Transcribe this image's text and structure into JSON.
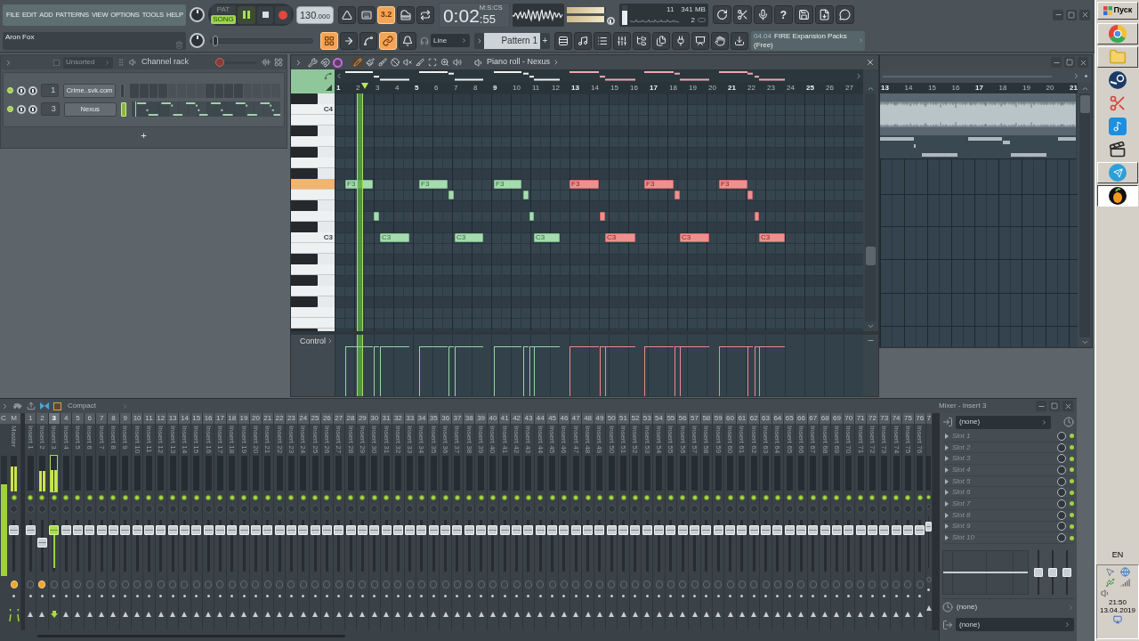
{
  "menu": [
    "FILE",
    "EDIT",
    "ADD",
    "PATTERNS",
    "VIEW",
    "OPTIONS",
    "TOOLS",
    "HELP"
  ],
  "hint_bar": {
    "text": "Aron Fox"
  },
  "transport": {
    "modes": [
      {
        "label": "PAT",
        "selected": false
      },
      {
        "label": "SONG",
        "selected": true
      }
    ],
    "playing": true,
    "tempo": "130",
    "tempo_decimals": ".000"
  },
  "toolbar": {
    "top": [
      {
        "on": false
      },
      {
        "on": false
      },
      {
        "label": "3.2",
        "on": true
      },
      {
        "on": false
      },
      {
        "on": false
      }
    ],
    "bottom": [
      {
        "on": true
      },
      {
        "on": false
      },
      {
        "on": false
      },
      {
        "on": true
      },
      {
        "on": false
      }
    ],
    "help_label": "?"
  },
  "time_display": {
    "value": "0:02",
    "centiseconds": ":55",
    "format": "M:S:CS"
  },
  "output_meter": {
    "left": {
      "level": 0.95
    },
    "right": {
      "level": 0.95
    }
  },
  "cpu_panel": {
    "cpu": {
      "level": 0.7
    },
    "cpu_value": "11",
    "memory": "341 MB",
    "polyphony": "2"
  },
  "pitch_slider": {
    "level": 0.05
  },
  "snap": {
    "value": "Line"
  },
  "pattern": {
    "name": "Pattern 1",
    "add": "+"
  },
  "news": {
    "date": "04.04",
    "title": "FIRE Expansion Packs",
    "subtitle": "(Free)"
  },
  "channel_rack": {
    "filter": "Unsorted",
    "title": "Channel rack",
    "slider": {
      "level": 0.1
    },
    "channels": [
      {
        "kind": "steps",
        "on": true,
        "number": "1",
        "name": "Crime..svk.com",
        "selected": false,
        "steps": [
          {
            "on": false
          },
          {
            "on": false
          },
          {
            "on": false
          },
          {
            "on": false
          },
          {
            "on": false
          },
          {
            "on": false
          },
          {
            "on": false
          },
          {
            "on": false
          },
          {
            "on": false
          },
          {
            "on": false
          },
          {
            "on": false
          },
          {
            "on": false
          },
          {
            "on": false
          },
          {
            "on": false
          },
          {
            "on": false
          },
          {
            "on": false
          }
        ]
      },
      {
        "kind": "piano_roll",
        "on": true,
        "number": "3",
        "name": "Nexus",
        "selected": true
      }
    ],
    "add": "+"
  },
  "piano_roll": {
    "title": "Piano roll - Nexus",
    "tools": [
      {
        "selected": true
      },
      {
        "selected": false
      },
      {
        "selected": false
      },
      {
        "selected": false
      },
      {
        "selected": false
      },
      {
        "selected": false
      },
      {
        "selected": false
      },
      {
        "selected": false
      },
      {
        "selected": false
      }
    ],
    "ruler": [
      "1",
      "2",
      "3",
      "4",
      "5",
      "6",
      "7",
      "8",
      "9",
      "10",
      "11",
      "12",
      "13",
      "14",
      "15",
      "16",
      "17",
      "18",
      "19",
      "20",
      "21",
      "22",
      "23",
      "24",
      "25",
      "26",
      "27"
    ],
    "keys": [
      {
        "label": "C4",
        "selected": false
      },
      {
        "selected": false
      },
      {
        "selected": false
      },
      {
        "selected": false
      },
      {
        "selected": true
      },
      {
        "selected": false
      },
      {
        "selected": false
      },
      {
        "label": "C3",
        "selected": false
      },
      {
        "selected": false
      },
      {
        "selected": false
      },
      {
        "selected": false
      },
      {
        "selected": false
      },
      {
        "selected": false
      }
    ],
    "notes": [
      {
        "label": "F3",
        "selected": false
      },
      {
        "selected": false
      },
      {
        "label": "C3",
        "selected": false
      },
      {
        "label": "F3",
        "selected": false
      },
      {
        "selected": false
      },
      {
        "label": "C3",
        "selected": false
      },
      {
        "label": "F3",
        "selected": false
      },
      {
        "selected": false
      },
      {
        "selected": false
      },
      {
        "label": "C3",
        "selected": false
      },
      {
        "label": "F3",
        "selected": true
      },
      {
        "selected": true
      },
      {
        "label": "C3",
        "selected": true
      },
      {
        "label": "F3",
        "selected": true
      },
      {
        "selected": true
      },
      {
        "label": "C3",
        "selected": true
      },
      {
        "label": "F3",
        "selected": true
      },
      {
        "selected": true
      },
      {
        "selected": true
      },
      {
        "label": "C3",
        "selected": true
      }
    ],
    "playhead": {
      "level": 0.047
    },
    "control_label": "Control"
  },
  "playlist": {
    "ruler": [
      "13",
      "14",
      "15",
      "16",
      "17",
      "18",
      "19",
      "20",
      "21"
    ]
  },
  "mixer": {
    "view": "Compact",
    "current": {
      "number": "C",
      "meter": {
        "level": 0.76
      }
    },
    "master": {
      "number": "M",
      "label": "Master",
      "on": true,
      "knob_lit": true,
      "meter": {
        "level": 0.7
      },
      "fader": {
        "level": 0.88
      }
    },
    "inserts": [
      {
        "number": "1",
        "label": "Insert 1",
        "selected": false,
        "on": true,
        "knob_lit": false,
        "meter": {
          "level": 0
        },
        "fader": {
          "level": 0.88
        }
      },
      {
        "number": "2",
        "label": "Insert 2",
        "selected": false,
        "on": true,
        "knob_lit": true,
        "meter": {
          "level": 0.58
        },
        "fader": {
          "level": 0.58
        }
      },
      {
        "number": "3",
        "label": "Insert 3",
        "selected": true,
        "on": true,
        "knob_lit": false,
        "meter": {
          "level": 0.6
        },
        "fader": {
          "level": 0.88
        }
      },
      {
        "number": "4",
        "label": "Insert 4",
        "selected": false,
        "on": true,
        "knob_lit": false,
        "meter": {
          "level": 0
        },
        "fader": {
          "level": 0.88
        }
      },
      {
        "number": "5",
        "label": "Insert 5",
        "selected": false,
        "on": true,
        "knob_lit": false,
        "meter": {
          "level": 0
        },
        "fader": {
          "level": 0.88
        }
      },
      {
        "number": "6",
        "label": "Insert 6",
        "selected": false,
        "on": true,
        "knob_lit": false,
        "meter": {
          "level": 0
        },
        "fader": {
          "level": 0.88
        }
      },
      {
        "number": "7",
        "label": "Insert 7",
        "selected": false,
        "on": true,
        "knob_lit": false,
        "meter": {
          "level": 0
        },
        "fader": {
          "level": 0.88
        }
      },
      {
        "number": "8",
        "label": "Insert 8",
        "selected": false,
        "on": true,
        "knob_lit": false,
        "meter": {
          "level": 0
        },
        "fader": {
          "level": 0.88
        }
      },
      {
        "number": "9",
        "label": "Insert 9",
        "selected": false,
        "on": true,
        "knob_lit": false,
        "meter": {
          "level": 0
        },
        "fader": {
          "level": 0.88
        }
      },
      {
        "number": "10",
        "label": "Insert 10",
        "selected": false,
        "on": true,
        "knob_lit": false,
        "meter": {
          "level": 0
        },
        "fader": {
          "level": 0.88
        }
      },
      {
        "number": "11",
        "label": "Insert 11",
        "selected": false,
        "on": true,
        "knob_lit": false,
        "meter": {
          "level": 0
        },
        "fader": {
          "level": 0.88
        }
      },
      {
        "number": "12",
        "label": "Insert 12",
        "selected": false,
        "on": true,
        "knob_lit": false,
        "meter": {
          "level": 0
        },
        "fader": {
          "level": 0.88
        }
      },
      {
        "number": "13",
        "label": "Insert 13",
        "selected": false,
        "on": true,
        "knob_lit": false,
        "meter": {
          "level": 0
        },
        "fader": {
          "level": 0.88
        }
      },
      {
        "number": "14",
        "label": "Insert 14",
        "selected": false,
        "on": true,
        "knob_lit": false,
        "meter": {
          "level": 0
        },
        "fader": {
          "level": 0.88
        }
      },
      {
        "number": "15",
        "label": "Insert 15",
        "selected": false,
        "on": true,
        "knob_lit": false,
        "meter": {
          "level": 0
        },
        "fader": {
          "level": 0.88
        }
      },
      {
        "number": "16",
        "label": "Insert 16",
        "selected": false,
        "on": true,
        "knob_lit": false,
        "meter": {
          "level": 0
        },
        "fader": {
          "level": 0.88
        }
      },
      {
        "number": "17",
        "label": "Insert 17",
        "selected": false,
        "on": true,
        "knob_lit": false,
        "meter": {
          "level": 0
        },
        "fader": {
          "level": 0.88
        }
      },
      {
        "number": "18",
        "label": "Insert 18",
        "selected": false,
        "on": true,
        "knob_lit": false,
        "meter": {
          "level": 0
        },
        "fader": {
          "level": 0.88
        }
      },
      {
        "number": "19",
        "label": "Insert 19",
        "selected": false,
        "on": true,
        "knob_lit": false,
        "meter": {
          "level": 0
        },
        "fader": {
          "level": 0.88
        }
      },
      {
        "number": "20",
        "label": "Insert 20",
        "selected": false,
        "on": true,
        "knob_lit": false,
        "meter": {
          "level": 0
        },
        "fader": {
          "level": 0.88
        }
      },
      {
        "number": "21",
        "label": "Insert 21",
        "selected": false,
        "on": true,
        "knob_lit": false,
        "meter": {
          "level": 0
        },
        "fader": {
          "level": 0.88
        }
      },
      {
        "number": "22",
        "label": "Insert 22",
        "selected": false,
        "on": true,
        "knob_lit": false,
        "meter": {
          "level": 0
        },
        "fader": {
          "level": 0.88
        }
      },
      {
        "number": "23",
        "label": "Insert 23",
        "selected": false,
        "on": true,
        "knob_lit": false,
        "meter": {
          "level": 0
        },
        "fader": {
          "level": 0.88
        }
      },
      {
        "number": "24",
        "label": "Insert 24",
        "selected": false,
        "on": true,
        "knob_lit": false,
        "meter": {
          "level": 0
        },
        "fader": {
          "level": 0.88
        }
      },
      {
        "number": "25",
        "label": "Insert 25",
        "selected": false,
        "on": true,
        "knob_lit": false,
        "meter": {
          "level": 0
        },
        "fader": {
          "level": 0.88
        }
      },
      {
        "number": "26",
        "label": "Insert 26",
        "selected": false,
        "on": true,
        "knob_lit": false,
        "meter": {
          "level": 0
        },
        "fader": {
          "level": 0.88
        }
      },
      {
        "number": "27",
        "label": "Insert 27",
        "selected": false,
        "on": true,
        "knob_lit": false,
        "meter": {
          "level": 0
        },
        "fader": {
          "level": 0.88
        }
      },
      {
        "number": "28",
        "label": "Insert 28",
        "selected": false,
        "on": true,
        "knob_lit": false,
        "meter": {
          "level": 0
        },
        "fader": {
          "level": 0.88
        }
      },
      {
        "number": "29",
        "label": "Insert 29",
        "selected": false,
        "on": true,
        "knob_lit": false,
        "meter": {
          "level": 0
        },
        "fader": {
          "level": 0.88
        }
      },
      {
        "number": "30",
        "label": "Insert 30",
        "selected": false,
        "on": true,
        "knob_lit": false,
        "meter": {
          "level": 0
        },
        "fader": {
          "level": 0.88
        }
      },
      {
        "number": "31",
        "label": "Insert 31",
        "selected": false,
        "on": true,
        "knob_lit": false,
        "meter": {
          "level": 0
        },
        "fader": {
          "level": 0.88
        }
      },
      {
        "number": "32",
        "label": "Insert 32",
        "selected": false,
        "on": true,
        "knob_lit": false,
        "meter": {
          "level": 0
        },
        "fader": {
          "level": 0.88
        }
      },
      {
        "number": "33",
        "label": "Insert 33",
        "selected": false,
        "on": true,
        "knob_lit": false,
        "meter": {
          "level": 0
        },
        "fader": {
          "level": 0.88
        }
      },
      {
        "number": "34",
        "label": "Insert 34",
        "selected": false,
        "on": true,
        "knob_lit": false,
        "meter": {
          "level": 0
        },
        "fader": {
          "level": 0.88
        }
      },
      {
        "number": "35",
        "label": "Insert 35",
        "selected": false,
        "on": true,
        "knob_lit": false,
        "meter": {
          "level": 0
        },
        "fader": {
          "level": 0.88
        }
      },
      {
        "number": "36",
        "label": "Insert 36",
        "selected": false,
        "on": true,
        "knob_lit": false,
        "meter": {
          "level": 0
        },
        "fader": {
          "level": 0.88
        }
      },
      {
        "number": "37",
        "label": "Insert 37",
        "selected": false,
        "on": true,
        "knob_lit": false,
        "meter": {
          "level": 0
        },
        "fader": {
          "level": 0.88
        }
      },
      {
        "number": "38",
        "label": "Insert 38",
        "selected": false,
        "on": true,
        "knob_lit": false,
        "meter": {
          "level": 0
        },
        "fader": {
          "level": 0.88
        }
      },
      {
        "number": "39",
        "label": "Insert 39",
        "selected": false,
        "on": true,
        "knob_lit": false,
        "meter": {
          "level": 0
        },
        "fader": {
          "level": 0.88
        }
      },
      {
        "number": "40",
        "label": "Insert 40",
        "selected": false,
        "on": true,
        "knob_lit": false,
        "meter": {
          "level": 0
        },
        "fader": {
          "level": 0.88
        }
      },
      {
        "number": "41",
        "label": "Insert 41",
        "selected": false,
        "on": true,
        "knob_lit": false,
        "meter": {
          "level": 0
        },
        "fader": {
          "level": 0.88
        }
      },
      {
        "number": "42",
        "label": "Insert 42",
        "selected": false,
        "on": true,
        "knob_lit": false,
        "meter": {
          "level": 0
        },
        "fader": {
          "level": 0.88
        }
      },
      {
        "number": "43",
        "label": "Insert 43",
        "selected": false,
        "on": true,
        "knob_lit": false,
        "meter": {
          "level": 0
        },
        "fader": {
          "level": 0.88
        }
      },
      {
        "number": "44",
        "label": "Insert 44",
        "selected": false,
        "on": true,
        "knob_lit": false,
        "meter": {
          "level": 0
        },
        "fader": {
          "level": 0.88
        }
      },
      {
        "number": "45",
        "label": "Insert 45",
        "selected": false,
        "on": true,
        "knob_lit": false,
        "meter": {
          "level": 0
        },
        "fader": {
          "level": 0.88
        }
      },
      {
        "number": "46",
        "label": "Insert 46",
        "selected": false,
        "on": true,
        "knob_lit": false,
        "meter": {
          "level": 0
        },
        "fader": {
          "level": 0.88
        }
      },
      {
        "number": "47",
        "label": "Insert 47",
        "selected": false,
        "on": true,
        "knob_lit": false,
        "meter": {
          "level": 0
        },
        "fader": {
          "level": 0.88
        }
      },
      {
        "number": "48",
        "label": "Insert 48",
        "selected": false,
        "on": true,
        "knob_lit": false,
        "meter": {
          "level": 0
        },
        "fader": {
          "level": 0.88
        }
      },
      {
        "number": "49",
        "label": "Insert 49",
        "selected": false,
        "on": true,
        "knob_lit": false,
        "meter": {
          "level": 0
        },
        "fader": {
          "level": 0.88
        }
      },
      {
        "number": "50",
        "label": "Insert 50",
        "selected": false,
        "on": true,
        "knob_lit": false,
        "meter": {
          "level": 0
        },
        "fader": {
          "level": 0.88
        }
      },
      {
        "number": "51",
        "label": "Insert 51",
        "selected": false,
        "on": true,
        "knob_lit": false,
        "meter": {
          "level": 0
        },
        "fader": {
          "level": 0.88
        }
      },
      {
        "number": "52",
        "label": "Insert 52",
        "selected": false,
        "on": true,
        "knob_lit": false,
        "meter": {
          "level": 0
        },
        "fader": {
          "level": 0.88
        }
      },
      {
        "number": "53",
        "label": "Insert 53",
        "selected": false,
        "on": true,
        "knob_lit": false,
        "meter": {
          "level": 0
        },
        "fader": {
          "level": 0.88
        }
      },
      {
        "number": "54",
        "label": "Insert 54",
        "selected": false,
        "on": true,
        "knob_lit": false,
        "meter": {
          "level": 0
        },
        "fader": {
          "level": 0.88
        }
      },
      {
        "number": "55",
        "label": "Insert 55",
        "selected": false,
        "on": true,
        "knob_lit": false,
        "meter": {
          "level": 0
        },
        "fader": {
          "level": 0.88
        }
      },
      {
        "number": "56",
        "label": "Insert 56",
        "selected": false,
        "on": true,
        "knob_lit": false,
        "meter": {
          "level": 0
        },
        "fader": {
          "level": 0.88
        }
      },
      {
        "number": "57",
        "label": "Insert 57",
        "selected": false,
        "on": true,
        "knob_lit": false,
        "meter": {
          "level": 0
        },
        "fader": {
          "level": 0.88
        }
      },
      {
        "number": "58",
        "label": "Insert 58",
        "selected": false,
        "on": true,
        "knob_lit": false,
        "meter": {
          "level": 0
        },
        "fader": {
          "level": 0.88
        }
      },
      {
        "number": "59",
        "label": "Insert 59",
        "selected": false,
        "on": true,
        "knob_lit": false,
        "meter": {
          "level": 0
        },
        "fader": {
          "level": 0.88
        }
      },
      {
        "number": "60",
        "label": "Insert 60",
        "selected": false,
        "on": true,
        "knob_lit": false,
        "meter": {
          "level": 0
        },
        "fader": {
          "level": 0.88
        }
      },
      {
        "number": "61",
        "label": "Insert 61",
        "selected": false,
        "on": true,
        "knob_lit": false,
        "meter": {
          "level": 0
        },
        "fader": {
          "level": 0.88
        }
      },
      {
        "number": "62",
        "label": "Insert 62",
        "selected": false,
        "on": true,
        "knob_lit": false,
        "meter": {
          "level": 0
        },
        "fader": {
          "level": 0.88
        }
      },
      {
        "number": "63",
        "label": "Insert 63",
        "selected": false,
        "on": true,
        "knob_lit": false,
        "meter": {
          "level": 0
        },
        "fader": {
          "level": 0.88
        }
      },
      {
        "number": "64",
        "label": "Insert 64",
        "selected": false,
        "on": true,
        "knob_lit": false,
        "meter": {
          "level": 0
        },
        "fader": {
          "level": 0.88
        }
      },
      {
        "number": "65",
        "label": "Insert 65",
        "selected": false,
        "on": true,
        "knob_lit": false,
        "meter": {
          "level": 0
        },
        "fader": {
          "level": 0.88
        }
      },
      {
        "number": "66",
        "label": "Insert 66",
        "selected": false,
        "on": true,
        "knob_lit": false,
        "meter": {
          "level": 0
        },
        "fader": {
          "level": 0.88
        }
      },
      {
        "number": "67",
        "label": "Insert 67",
        "selected": false,
        "on": true,
        "knob_lit": false,
        "meter": {
          "level": 0
        },
        "fader": {
          "level": 0.88
        }
      },
      {
        "number": "68",
        "label": "Insert 68",
        "selected": false,
        "on": true,
        "knob_lit": false,
        "meter": {
          "level": 0
        },
        "fader": {
          "level": 0.88
        }
      },
      {
        "number": "69",
        "label": "Insert 69",
        "selected": false,
        "on": true,
        "knob_lit": false,
        "meter": {
          "level": 0
        },
        "fader": {
          "level": 0.88
        }
      },
      {
        "number": "70",
        "label": "Insert 70",
        "selected": false,
        "on": true,
        "knob_lit": false,
        "meter": {
          "level": 0
        },
        "fader": {
          "level": 0.88
        }
      },
      {
        "number": "71",
        "label": "Insert 71",
        "selected": false,
        "on": true,
        "knob_lit": false,
        "meter": {
          "level": 0
        },
        "fader": {
          "level": 0.88
        }
      },
      {
        "number": "72",
        "label": "Insert 72",
        "selected": false,
        "on": true,
        "knob_lit": false,
        "meter": {
          "level": 0
        },
        "fader": {
          "level": 0.88
        }
      },
      {
        "number": "73",
        "label": "Insert 73",
        "selected": false,
        "on": true,
        "knob_lit": false,
        "meter": {
          "level": 0
        },
        "fader": {
          "level": 0.88
        }
      },
      {
        "number": "74",
        "label": "Insert 74",
        "selected": false,
        "on": true,
        "knob_lit": false,
        "meter": {
          "level": 0
        },
        "fader": {
          "level": 0.88
        }
      },
      {
        "number": "75",
        "label": "Insert 75",
        "selected": false,
        "on": true,
        "knob_lit": false,
        "meter": {
          "level": 0
        },
        "fader": {
          "level": 0.88
        }
      },
      {
        "number": "76",
        "label": "Insert 76",
        "selected": false,
        "on": true,
        "knob_lit": false,
        "meter": {
          "level": 0
        },
        "fader": {
          "level": 0.88
        }
      },
      {
        "number": "7",
        "selected": false,
        "on": true,
        "knob_lit": false,
        "meter": {
          "level": 0
        },
        "fader": {
          "level": 0.88
        }
      }
    ]
  },
  "insert_panel": {
    "title": "Mixer - Insert 3",
    "input": "(none)",
    "slots": [
      {
        "label": "Slot 1",
        "on": true
      },
      {
        "label": "Slot 2",
        "on": true
      },
      {
        "label": "Slot 3",
        "on": true
      },
      {
        "label": "Slot 4",
        "on": true
      },
      {
        "label": "Slot 5",
        "on": true
      },
      {
        "label": "Slot 6",
        "on": true
      },
      {
        "label": "Slot 7",
        "on": true
      },
      {
        "label": "Slot 8",
        "on": true
      },
      {
        "label": "Slot 9",
        "on": true
      },
      {
        "label": "Slot 10",
        "on": true
      }
    ],
    "eq_bands": [
      {
        "level": 0.5
      },
      {
        "level": 0.5
      },
      {
        "level": 0.5
      }
    ],
    "send": "(none)",
    "output": "(none)"
  },
  "taskbar": {
    "start": "Пуск",
    "apps": [
      {
        "open": true,
        "selected": false
      },
      {
        "open": true,
        "selected": false
      },
      {
        "open": false,
        "selected": false
      },
      {
        "open": false,
        "selected": false
      },
      {
        "open": false,
        "selected": false
      },
      {
        "open": false,
        "selected": false
      },
      {
        "open": true,
        "selected": false
      },
      {
        "open": true,
        "selected": true
      }
    ],
    "language": "EN",
    "time": "21:50",
    "date": "13.04.2019"
  }
}
